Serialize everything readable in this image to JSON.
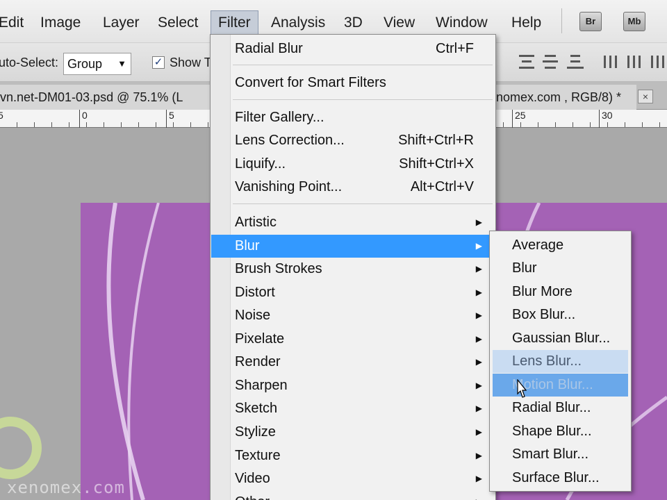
{
  "menubar": {
    "items": [
      "Edit",
      "Image",
      "Layer",
      "Select",
      "Filter",
      "Analysis",
      "3D",
      "View",
      "Window",
      "Help"
    ],
    "active": "Filter",
    "bridge_button": "Br",
    "minibridge_button": "Mb"
  },
  "options": {
    "auto_select_label": "uto-Select:",
    "auto_select_value": "Group",
    "show_transform_label": "Show T",
    "show_transform_checked": true
  },
  "tabs": {
    "doc1": "vn.net-DM01-03.psd @ 75.1% (L",
    "doc2": "nomex.com , RGB/8) *",
    "close": "×"
  },
  "ruler": {
    "labels": [
      "5",
      "0",
      "5",
      "25",
      "30"
    ]
  },
  "canvas": {
    "color": "#a462b5",
    "watermark": "xenomex.com"
  },
  "filter_menu": {
    "items": [
      {
        "label": "Radial Blur",
        "shortcut": "Ctrl+F"
      },
      {
        "label": "Convert for Smart Filters",
        "shortcut": ""
      },
      {
        "label": "Filter Gallery...",
        "shortcut": ""
      },
      {
        "label": "Lens Correction...",
        "shortcut": "Shift+Ctrl+R"
      },
      {
        "label": "Liquify...",
        "shortcut": "Shift+Ctrl+X"
      },
      {
        "label": "Vanishing Point...",
        "shortcut": "Alt+Ctrl+V"
      },
      {
        "label": "Artistic",
        "shortcut": ""
      },
      {
        "label": "Blur",
        "shortcut": ""
      },
      {
        "label": "Brush Strokes",
        "shortcut": ""
      },
      {
        "label": "Distort",
        "shortcut": ""
      },
      {
        "label": "Noise",
        "shortcut": ""
      },
      {
        "label": "Pixelate",
        "shortcut": ""
      },
      {
        "label": "Render",
        "shortcut": ""
      },
      {
        "label": "Sharpen",
        "shortcut": ""
      },
      {
        "label": "Sketch",
        "shortcut": ""
      },
      {
        "label": "Stylize",
        "shortcut": ""
      },
      {
        "label": "Texture",
        "shortcut": ""
      },
      {
        "label": "Video",
        "shortcut": ""
      },
      {
        "label": "Other",
        "shortcut": ""
      }
    ],
    "highlighted": "Blur",
    "submenu_arrow_icon": "triangle-right-icon"
  },
  "blur_submenu": {
    "items": [
      "Average",
      "Blur",
      "Blur More",
      "Box Blur...",
      "Gaussian Blur...",
      "Lens Blur...",
      "Motion Blur...",
      "Radial Blur...",
      "Shape Blur...",
      "Smart Blur...",
      "Surface Blur..."
    ],
    "hovered": "Motion Blur...",
    "secondary_hover": "Lens Blur..."
  },
  "colors": {
    "highlight": "#3399ff",
    "canvas_purple": "#a462b5"
  }
}
